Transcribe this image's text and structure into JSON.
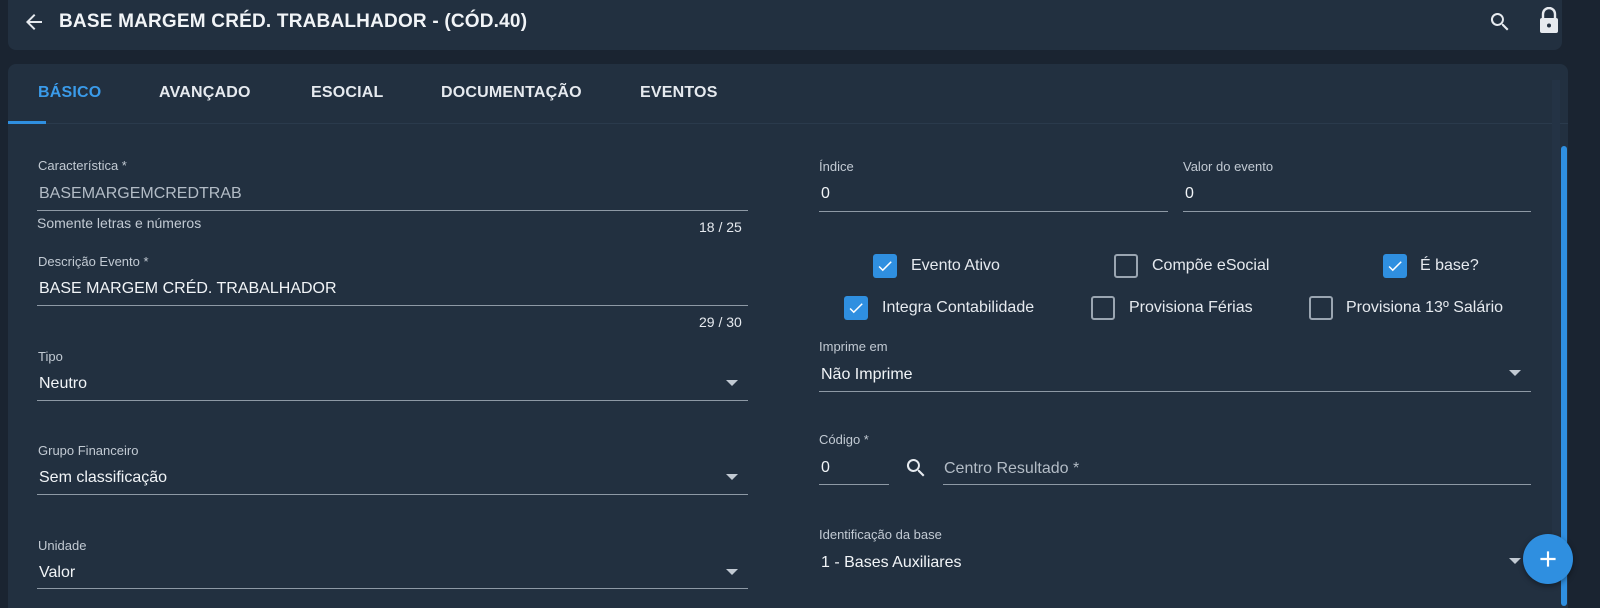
{
  "header": {
    "title": "BASE MARGEM CRÉD. TRABALHADOR - (CÓD.40)",
    "icons": {
      "back": "arrow-left-icon",
      "search": "search-icon",
      "lock": "lock-icon"
    }
  },
  "tabs": [
    {
      "label": "BÁSICO",
      "active": true
    },
    {
      "label": "AVANÇADO",
      "active": false
    },
    {
      "label": "ESOCIAL",
      "active": false
    },
    {
      "label": "DOCUMENTAÇÃO",
      "active": false
    },
    {
      "label": "EVENTOS",
      "active": false
    }
  ],
  "left": {
    "caracteristica": {
      "label": "Característica *",
      "value": "BASEMARGEMCREDTRAB",
      "helper": "Somente letras e números",
      "counter": "18 / 25"
    },
    "descricao": {
      "label": "Descrição Evento *",
      "value": "BASE MARGEM CRÉD. TRABALHADOR",
      "counter": "29 / 30"
    },
    "tipo": {
      "label": "Tipo",
      "value": "Neutro"
    },
    "grupo": {
      "label": "Grupo Financeiro",
      "value": "Sem classificação"
    },
    "unidade": {
      "label": "Unidade",
      "value": "Valor"
    }
  },
  "right": {
    "indice": {
      "label": "Índice",
      "value": "0"
    },
    "valor_evento": {
      "label": "Valor do evento",
      "value": "0"
    },
    "checkboxes": [
      {
        "label": "Evento Ativo",
        "checked": true
      },
      {
        "label": "Compõe eSocial",
        "checked": false
      },
      {
        "label": "É base?",
        "checked": true
      },
      {
        "label": "Integra Contabilidade",
        "checked": true
      },
      {
        "label": "Provisiona Férias",
        "checked": false
      },
      {
        "label": "Provisiona 13º Salário",
        "checked": false
      }
    ],
    "imprime": {
      "label": "Imprime em",
      "value": "Não Imprime"
    },
    "codigo": {
      "label": "Código *",
      "value": "0"
    },
    "centro": {
      "placeholder": "Centro Resultado *"
    },
    "identificacao": {
      "label": "Identificação da base",
      "value": "1 - Bases Auxiliares"
    }
  },
  "colors": {
    "accent": "#2f8fe0",
    "background": "#1a2431",
    "surface": "#223040"
  }
}
